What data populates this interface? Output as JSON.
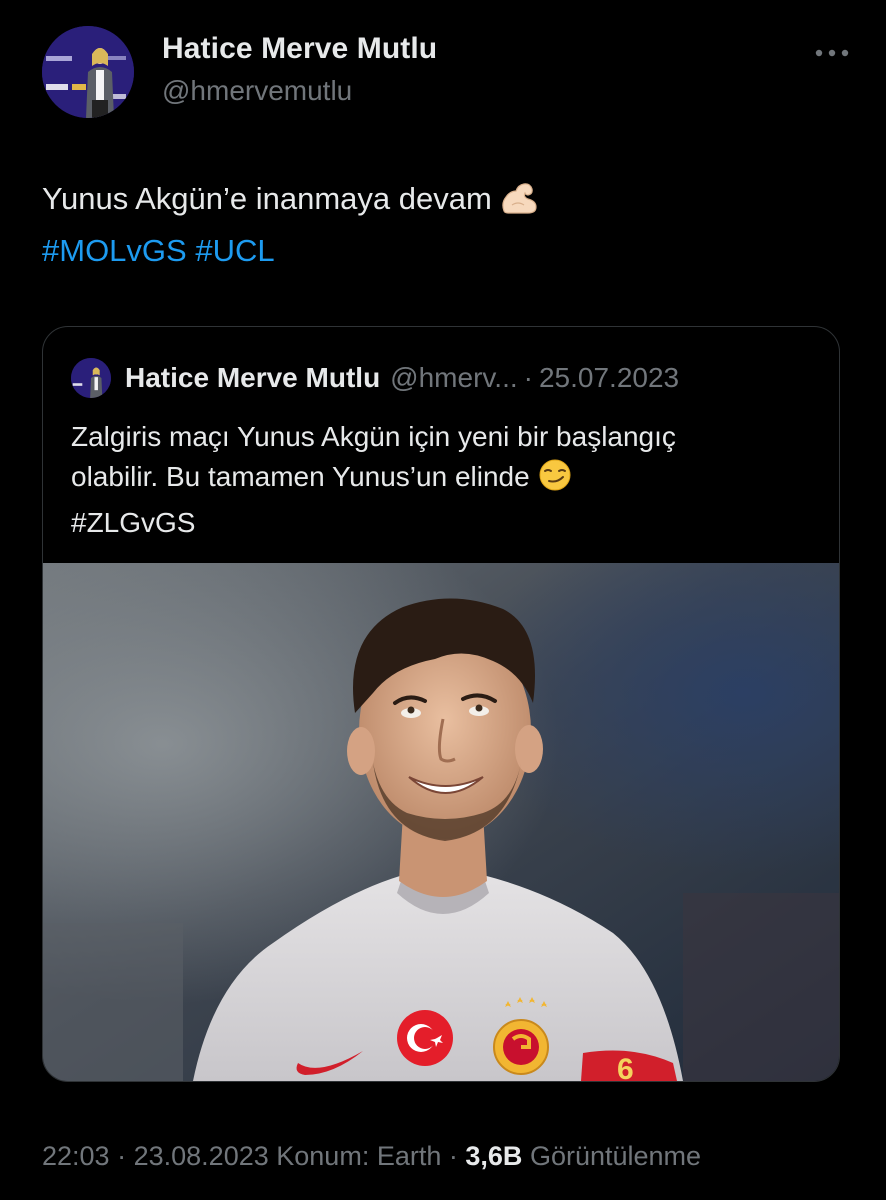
{
  "author": {
    "display_name": "Hatice Merve Mutlu",
    "handle": "@hmervemutlu",
    "avatar": "profile-avatar"
  },
  "more_icon": "more-horizontal-icon",
  "tweet": {
    "text": "Yunus Akgün’e inanmaya devam",
    "emoji": "flexed-biceps",
    "hashtags": [
      "#MOLvGS",
      "#UCL"
    ]
  },
  "quoted_tweet": {
    "display_name": "Hatice Merve Mutlu",
    "handle": "@hmerv...",
    "separator": "·",
    "date": "25.07.2023",
    "text_lines": [
      "Zalgiris maçı Yunus Akgün için yeni bir başlangıç",
      "olabilir. Bu tamamen Yunus’un elinde"
    ],
    "emoji": "smirking-face",
    "hashtag": "#ZLGvGS",
    "image": "player-photo"
  },
  "meta": {
    "time": "22:03",
    "sep1": "·",
    "date": "23.08.2023",
    "location": "Konum: Earth",
    "sep2": "·",
    "views_count": "3,6B",
    "views_label": "Görüntülenme"
  }
}
